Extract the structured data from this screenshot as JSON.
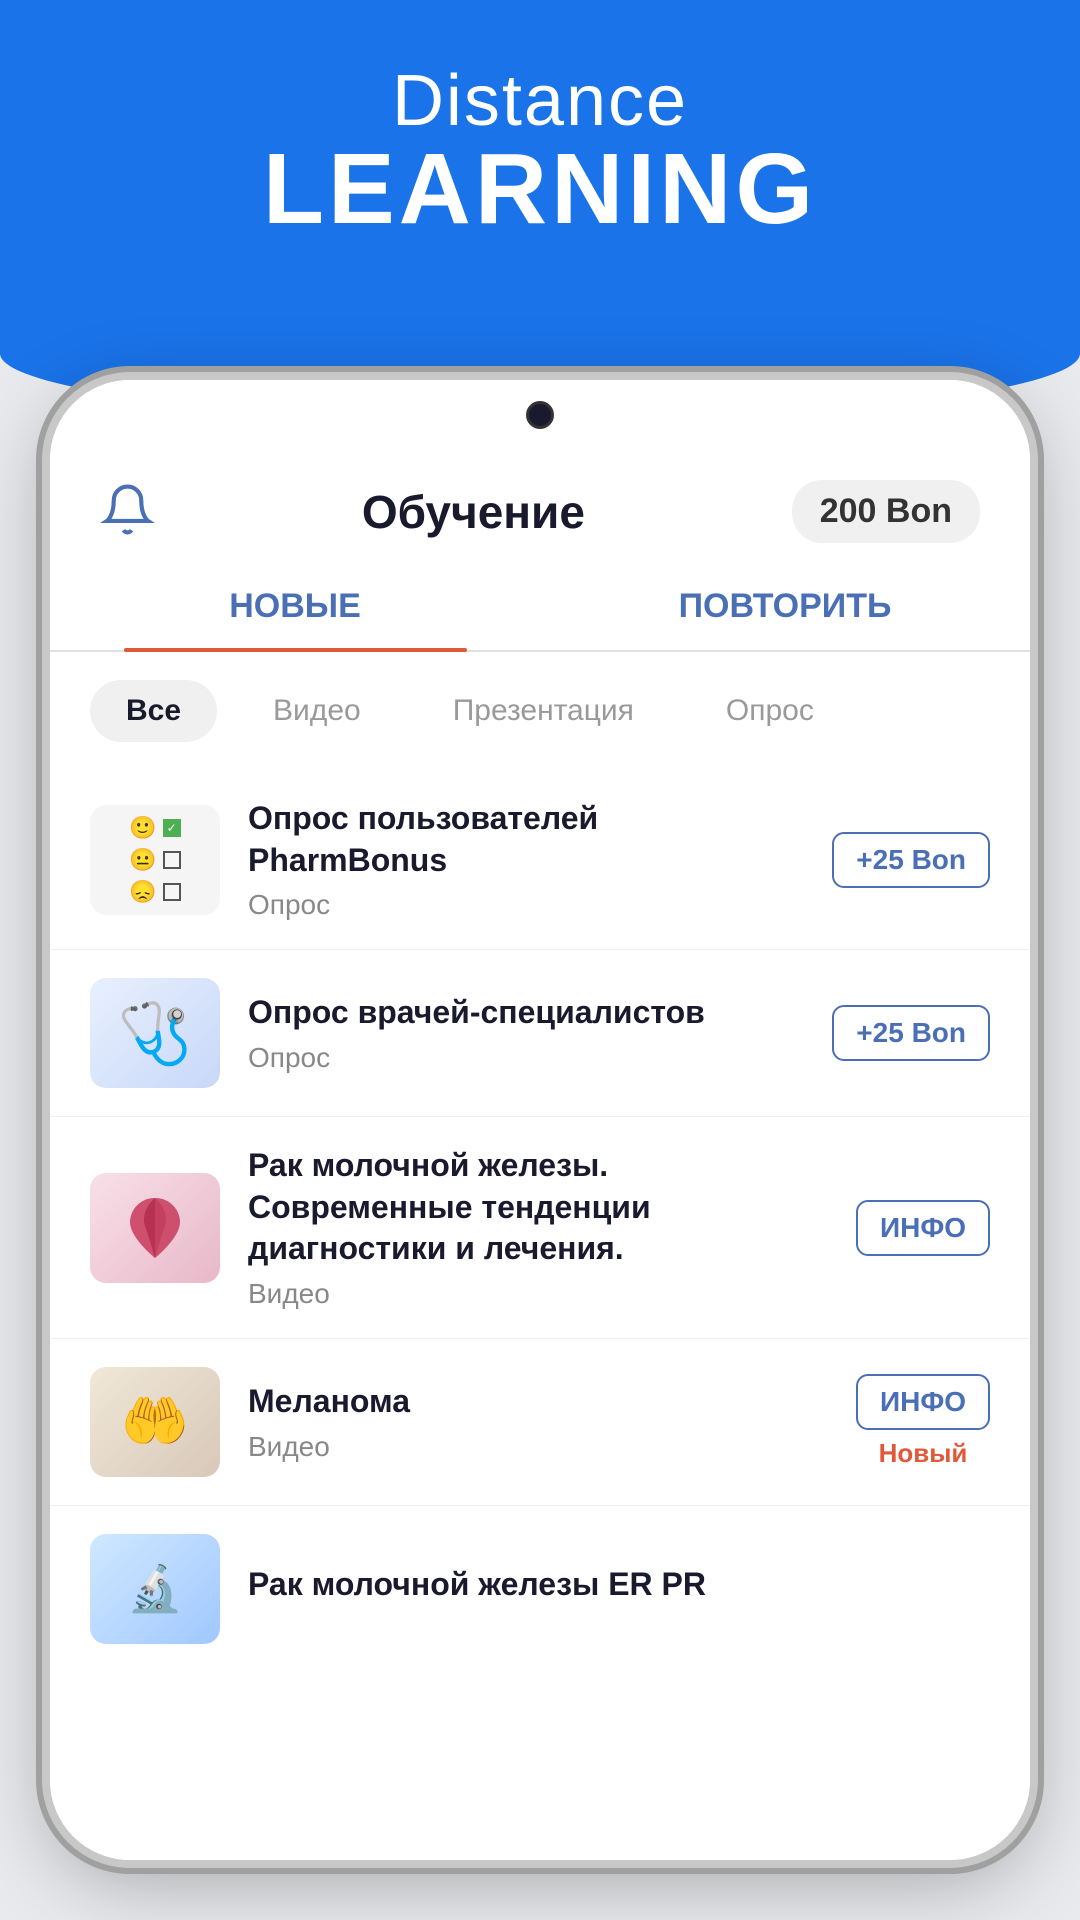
{
  "header": {
    "line1": "Distance",
    "line2": "LEARNING"
  },
  "app": {
    "title": "Обучение",
    "bonus": "200 Bon",
    "tabs": [
      {
        "label": "НОВЫЕ",
        "active": true
      },
      {
        "label": "ПОВТОРИТЬ",
        "active": false
      }
    ],
    "filters": [
      {
        "label": "Все",
        "active": true
      },
      {
        "label": "Видео",
        "active": false
      },
      {
        "label": "Презентация",
        "active": false
      },
      {
        "label": "Опрос",
        "active": false
      }
    ],
    "items": [
      {
        "title": "Опрос пользователей PharmBonus",
        "subtitle": "Опрос",
        "badge": "+25 Bon",
        "type": "survey",
        "extra": ""
      },
      {
        "title": "Опрос врачей-специалистов",
        "subtitle": "Опрос",
        "badge": "+25 Bon",
        "type": "doctor",
        "extra": ""
      },
      {
        "title": "Рак молочной железы. Современные тенденции диагностики и лечения.",
        "subtitle": "Видео",
        "badge": "ИНФО",
        "type": "ribbon",
        "extra": ""
      },
      {
        "title": "Меланома",
        "subtitle": "Видео",
        "badge": "ИНФО",
        "type": "melanoma",
        "extra": "Новый"
      },
      {
        "title": "Рак молочной железы ER PR",
        "subtitle": "",
        "badge": "",
        "type": "partial",
        "extra": ""
      }
    ]
  }
}
